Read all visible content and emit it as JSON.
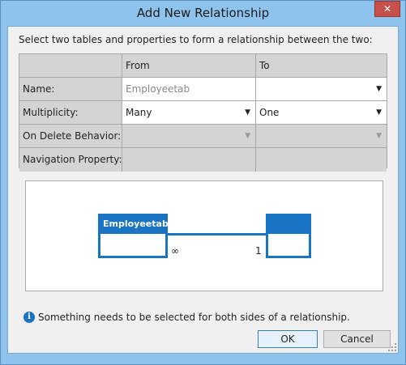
{
  "window": {
    "title": "Add New Relationship",
    "close_label": "✕"
  },
  "instruction": "Select two tables and properties to form a relationship between the two:",
  "grid": {
    "headers": {
      "blank": "",
      "from": "From",
      "to": "To"
    },
    "rows": [
      {
        "label": "Name:",
        "from": "Employeetab",
        "to": ""
      },
      {
        "label": "Multiplicity:",
        "from": "Many",
        "to": "One"
      },
      {
        "label": "On Delete Behavior:",
        "from": "",
        "to": ""
      },
      {
        "label": "Navigation Property:",
        "from": "",
        "to": ""
      }
    ]
  },
  "diagram": {
    "left_entity": "Employeetab",
    "right_entity": "",
    "left_multiplicity": "∞",
    "right_multiplicity": "1"
  },
  "info": {
    "icon": "info-icon",
    "text": "Something needs to be selected for both sides of a relationship."
  },
  "buttons": {
    "ok": "OK",
    "cancel": "Cancel"
  },
  "colors": {
    "accent": "#1a74c4",
    "frame": "#8ec3ee",
    "close": "#c7504a"
  }
}
